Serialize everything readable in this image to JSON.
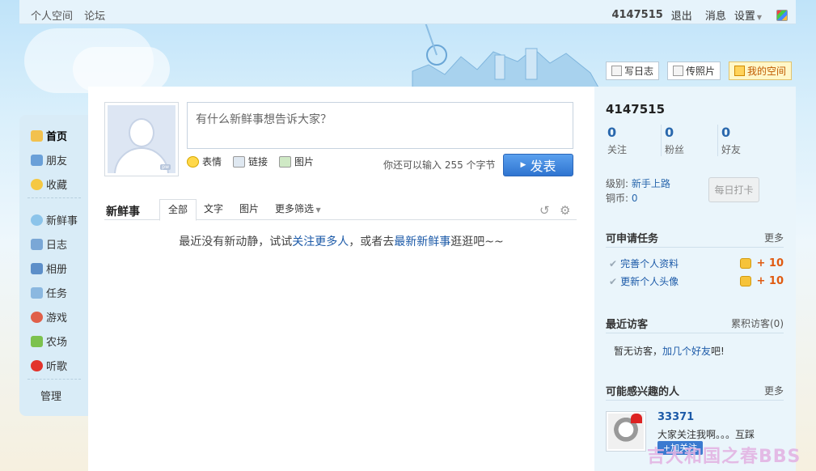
{
  "topbar": {
    "personal_space": "个人空间",
    "forum": "论坛",
    "user_id": "4147515",
    "logout": "退出",
    "messages": "消息",
    "settings": "设置"
  },
  "actions": {
    "write_blog": "写日志",
    "upload_photo": "传照片",
    "my_space": "我的空间"
  },
  "nav": {
    "items": [
      {
        "label": "首页",
        "icon": "home-icon",
        "active": true
      },
      {
        "label": "朋友",
        "icon": "friends-icon"
      },
      {
        "label": "收藏",
        "icon": "star-icon"
      },
      {
        "label": "新鲜事",
        "icon": "speech-bubble-icon"
      },
      {
        "label": "日志",
        "icon": "journal-icon"
      },
      {
        "label": "相册",
        "icon": "album-icon"
      },
      {
        "label": "任务",
        "icon": "task-icon"
      },
      {
        "label": "游戏",
        "icon": "game-icon"
      },
      {
        "label": "农场",
        "icon": "farm-icon"
      },
      {
        "label": "听歌",
        "icon": "music-icon"
      }
    ],
    "manage": "管理"
  },
  "composer": {
    "placeholder": "有什么新鲜事想告诉大家？",
    "tools": [
      "表情",
      "链接",
      "图片"
    ],
    "counter": "你还可以输入 255 个字节",
    "post": "发表"
  },
  "feed": {
    "title": "新鲜事",
    "tabs": [
      "全部",
      "文字",
      "图片",
      "更多筛选"
    ],
    "empty_prefix": "最近没有新动静，试试",
    "empty_link1": "关注更多人",
    "empty_mid": "，或者去",
    "empty_link2": "最新新鲜事",
    "empty_suffix": "逛逛吧~~"
  },
  "profile": {
    "user_id": "4147515",
    "stats": [
      {
        "value": "0",
        "label": "关注"
      },
      {
        "value": "0",
        "label": "粉丝"
      },
      {
        "value": "0",
        "label": "好友"
      }
    ],
    "level_label": "级别:",
    "level_value": "新手上路",
    "coins_label": "铜币:",
    "coins_value": "0",
    "checkin": "每日打卡"
  },
  "tasks": {
    "title": "可申请任务",
    "more": "更多",
    "items": [
      {
        "label": "完善个人资料",
        "reward": "+ 10"
      },
      {
        "label": "更新个人头像",
        "reward": "+ 10"
      }
    ]
  },
  "visitors": {
    "title": "最近访客",
    "total": "累积访客(0)",
    "empty_prefix": "暂无访客，",
    "empty_link": "加几个好友",
    "empty_suffix": "吧!"
  },
  "recommend": {
    "title": "可能感兴趣的人",
    "more": "更多",
    "name": "33371",
    "desc": "大家关注我啊。。。互踩",
    "follow": "+加关注"
  },
  "watermark": "吉大和国之春BBS"
}
